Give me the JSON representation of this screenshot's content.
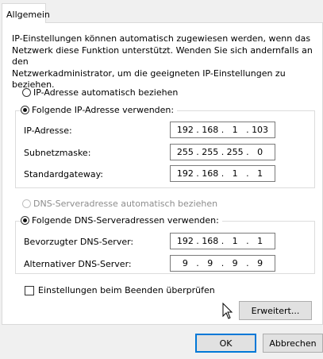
{
  "tab": {
    "label": "Allgemein"
  },
  "intro": {
    "line1": "IP-Einstellungen können automatisch zugewiesen werden, wenn das",
    "line2": "Netzwerk diese Funktion unterstützt. Wenden Sie sich andernfalls an den",
    "line3": "Netzwerkadministrator, um die geeigneten IP-Einstellungen zu beziehen."
  },
  "ip": {
    "auto_label": "IP-Adresse automatisch beziehen",
    "manual_label": "Folgende IP-Adresse verwenden:",
    "selected": "manual",
    "fields": {
      "address": {
        "label": "IP-Adresse:",
        "octets": [
          "192",
          "168",
          "1",
          "103"
        ]
      },
      "subnet": {
        "label": "Subnetzmaske:",
        "octets": [
          "255",
          "255",
          "255",
          "0"
        ]
      },
      "gateway": {
        "label": "Standardgateway:",
        "octets": [
          "192",
          "168",
          "1",
          "1"
        ]
      }
    }
  },
  "dns": {
    "auto_label": "DNS-Serveradresse automatisch beziehen",
    "manual_label": "Folgende DNS-Serveradressen verwenden:",
    "selected": "manual",
    "fields": {
      "preferred": {
        "label": "Bevorzugter DNS-Server:",
        "octets": [
          "192",
          "168",
          "1",
          "1"
        ]
      },
      "alternate": {
        "label": "Alternativer DNS-Server:",
        "octets": [
          "9",
          "9",
          "9",
          "9"
        ]
      }
    }
  },
  "validate_checkbox": {
    "label": "Einstellungen beim Beenden überprüfen",
    "checked": false
  },
  "buttons": {
    "advanced": "Erweitert...",
    "ok": "OK",
    "cancel": "Abbrechen"
  },
  "colors": {
    "window_bg": "#f0f0f0",
    "panel_bg": "#ffffff",
    "focus_border": "#0078d7"
  }
}
